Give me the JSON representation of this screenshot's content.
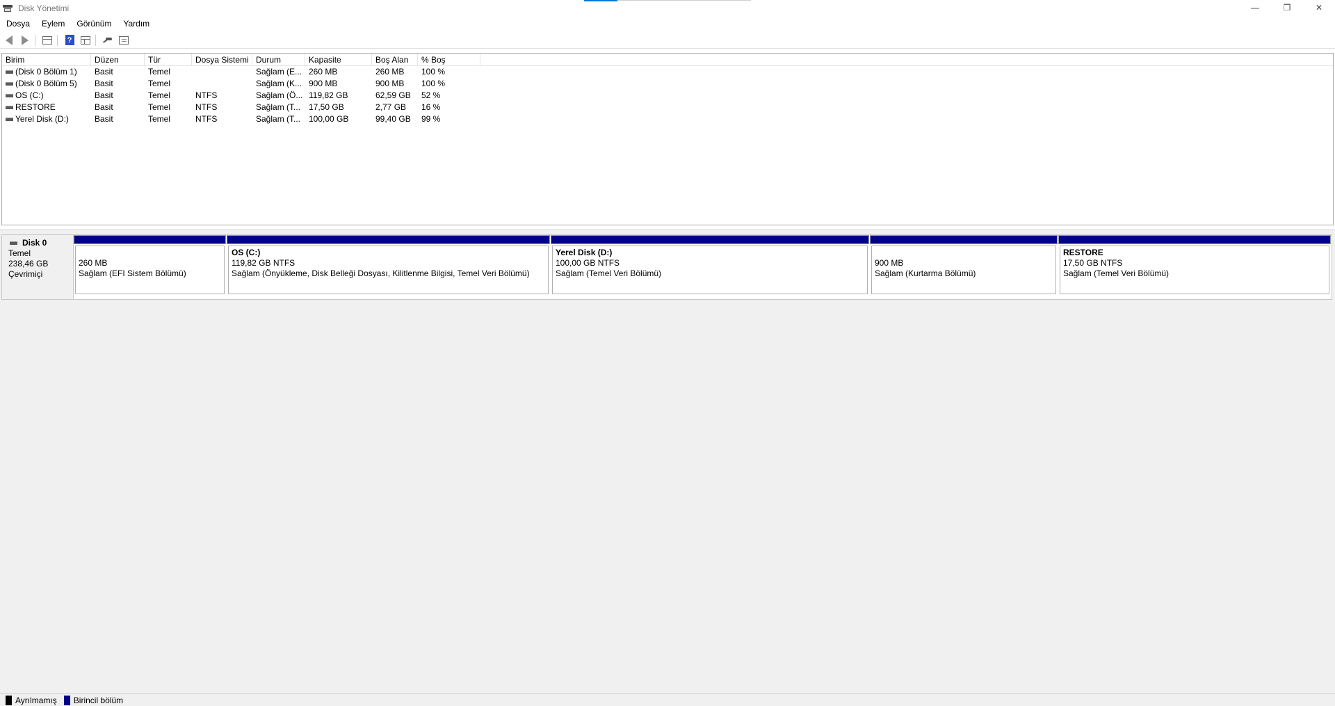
{
  "window": {
    "title": "Disk Yönetimi",
    "controls": {
      "minimize": "—",
      "restore": "❐",
      "close": "✕"
    }
  },
  "menu": [
    "Dosya",
    "Eylem",
    "Görünüm",
    "Yardım"
  ],
  "toolbar": {
    "icons": [
      "back-icon",
      "forward-icon",
      "console-tree-icon",
      "help-icon",
      "details-pane-icon",
      "connect-icon",
      "properties-icon"
    ]
  },
  "volume_list": {
    "columns": [
      "Birim",
      "Düzen",
      "Tür",
      "Dosya Sistemi",
      "Durum",
      "Kapasite",
      "Boş Alan",
      "% Boş"
    ],
    "rows": [
      [
        "(Disk 0 Bölüm 1)",
        "Basit",
        "Temel",
        "",
        "Sağlam (E...",
        "260 MB",
        "260 MB",
        "100 %"
      ],
      [
        "(Disk 0 Bölüm 5)",
        "Basit",
        "Temel",
        "",
        "Sağlam (K...",
        "900 MB",
        "900 MB",
        "100 %"
      ],
      [
        "OS (C:)",
        "Basit",
        "Temel",
        "NTFS",
        "Sağlam (Ö...",
        "119,82 GB",
        "62,59 GB",
        "52 %"
      ],
      [
        "RESTORE",
        "Basit",
        "Temel",
        "NTFS",
        "Sağlam (T...",
        "17,50 GB",
        "2,77 GB",
        "16 %"
      ],
      [
        "Yerel Disk (D:)",
        "Basit",
        "Temel",
        "NTFS",
        "Sağlam (T...",
        "100,00 GB",
        "99,40 GB",
        "99 %"
      ]
    ]
  },
  "disk": {
    "name": "Disk 0",
    "type": "Temel",
    "size": "238,46 GB",
    "status": "Çevrimiçi",
    "partitions": [
      {
        "name": "",
        "size": "260 MB",
        "status": "Sağlam (EFI Sistem Bölümü)"
      },
      {
        "name": "OS  (C:)",
        "size": "119,82 GB NTFS",
        "status": "Sağlam (Önyükleme, Disk Belleği Dosyası, Kilitlenme Bilgisi, Temel Veri Bölümü)"
      },
      {
        "name": "Yerel Disk  (D:)",
        "size": "100,00 GB NTFS",
        "status": "Sağlam (Temel Veri Bölümü)"
      },
      {
        "name": "",
        "size": "900 MB",
        "status": "Sağlam (Kurtarma Bölümü)"
      },
      {
        "name": "RESTORE",
        "size": "17,50 GB NTFS",
        "status": "Sağlam (Temel Veri Bölümü)"
      }
    ]
  },
  "legend": [
    {
      "label": "Ayrılmamış",
      "color": "#000000"
    },
    {
      "label": "Birincil bölüm",
      "color": "#00008b"
    }
  ],
  "colors": {
    "primary_partition": "#00008b",
    "title_accent": "#0078d7"
  }
}
